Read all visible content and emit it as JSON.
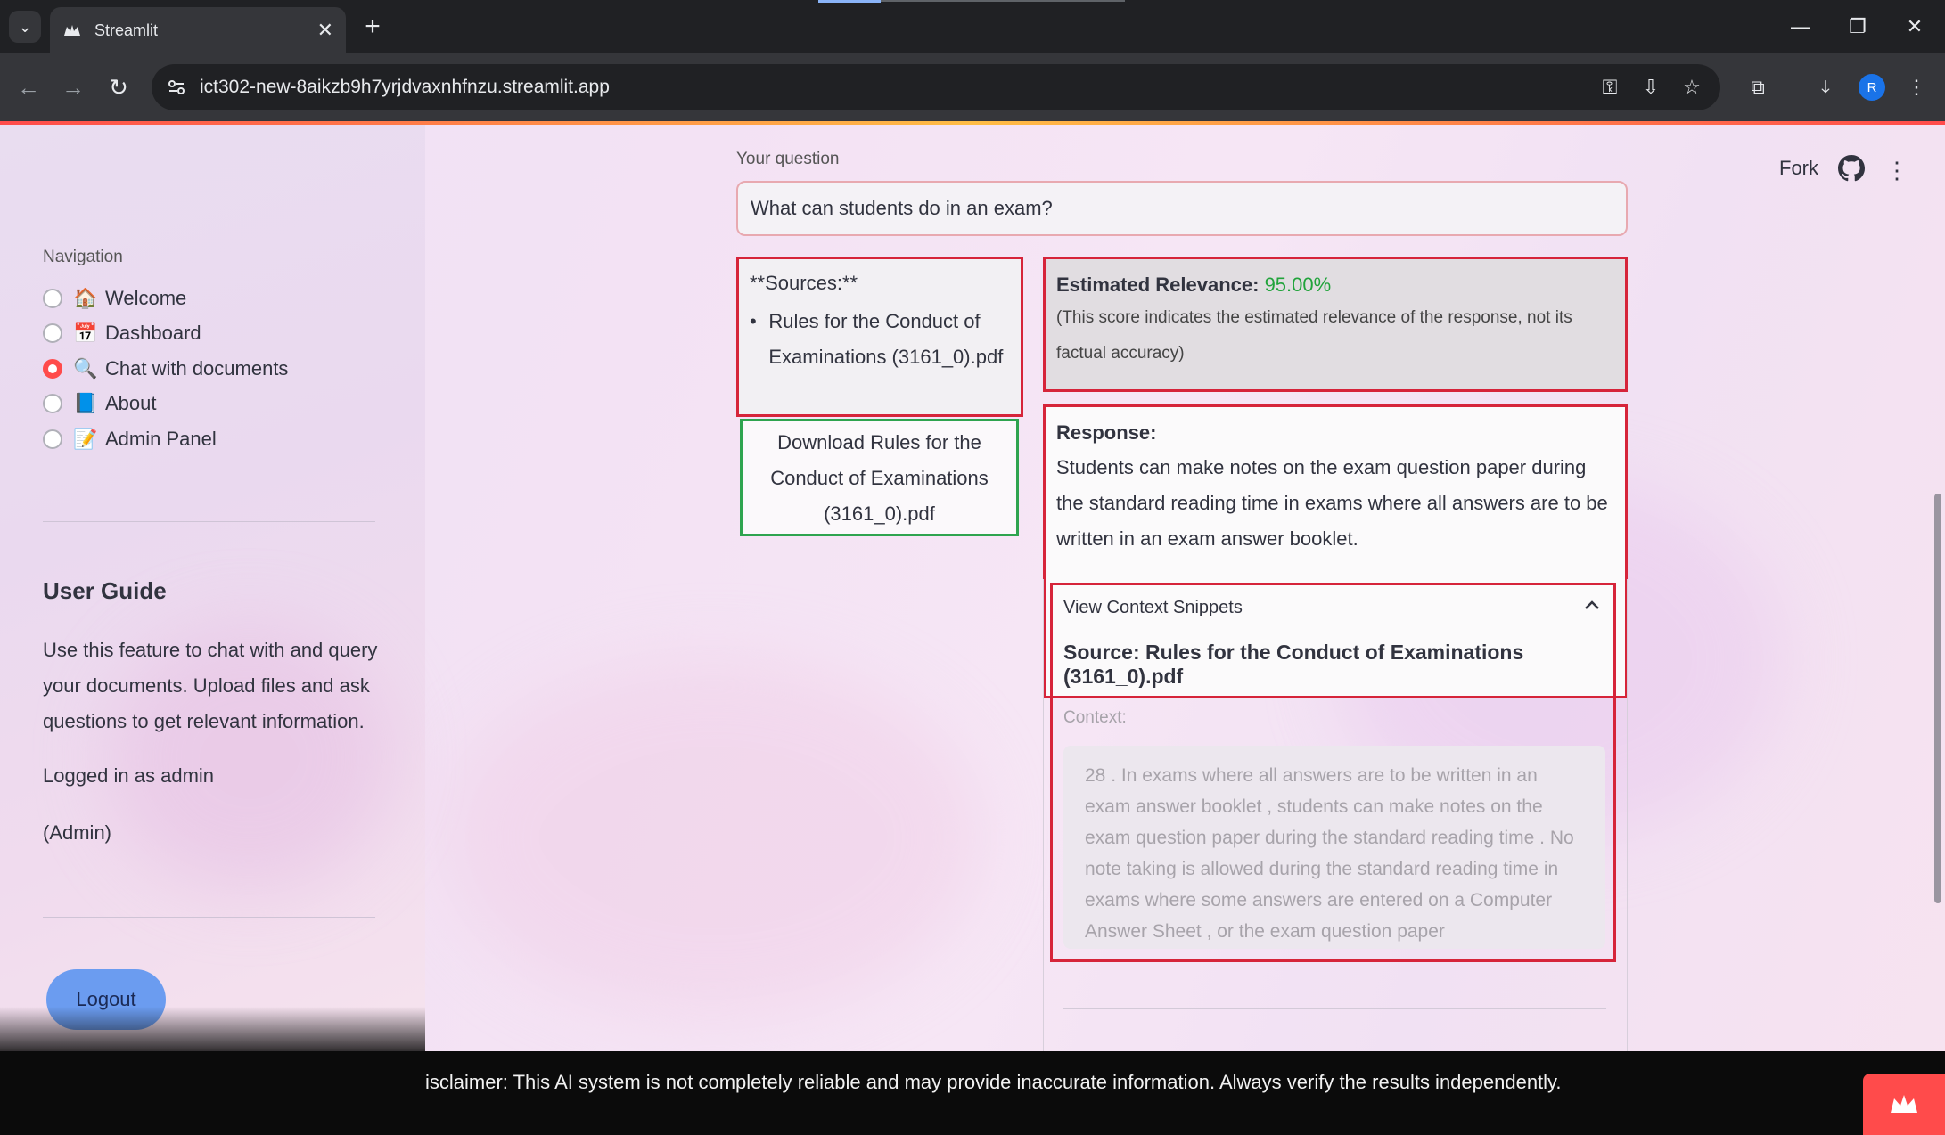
{
  "browser": {
    "tab_title": "Streamlit",
    "url": "ict302-new-8aikzb9h7yrjdvaxnhfnzu.streamlit.app",
    "profile_initial": "R"
  },
  "sidebar": {
    "nav_heading": "Navigation",
    "nav_items": [
      {
        "label": "Welcome",
        "icon": "house-icon",
        "selected": false
      },
      {
        "label": "Dashboard",
        "icon": "calendar-icon",
        "selected": false
      },
      {
        "label": "Chat with documents",
        "icon": "magnifier-icon",
        "selected": true
      },
      {
        "label": "About",
        "icon": "book-icon",
        "selected": false
      },
      {
        "label": "Admin Panel",
        "icon": "memo-icon",
        "selected": false
      }
    ],
    "guide_title": "User Guide",
    "guide_text": "Use this feature to chat with and query your documents. Upload files and ask questions to get relevant information.",
    "logged_in": "Logged in as admin",
    "role": "(Admin)",
    "logout_label": "Logout"
  },
  "header": {
    "fork_label": "Fork"
  },
  "main": {
    "question_label": "Your question",
    "question_value": "What can students do in an exam?",
    "sources_heading": "**Sources:**",
    "sources": [
      "Rules for the Conduct of Examinations (3161_0).pdf"
    ],
    "download_label": "Download Rules for the Conduct of Examinations (3161_0).pdf",
    "relevance_label": "Estimated Relevance:",
    "relevance_value": "95.00%",
    "relevance_note": "(This score indicates the estimated relevance of the response, not its factual accuracy)",
    "response_heading": "Response:",
    "response_text": "Students can make notes on the exam question paper during the standard reading time in exams where all answers are to be written in an exam answer booklet.",
    "expander_title": "View Context Snippets",
    "context_source": "Source: Rules for the Conduct of Examinations (3161_0).pdf",
    "context_label": "Context:",
    "context_text": "28 . In exams where all answers are to be written in an exam answer booklet , students can make notes on the exam question paper during the standard reading time . No note taking is allowed during the standard reading time in exams where some answers are entered on a Computer Answer Sheet , or the exam question paper"
  },
  "footer": {
    "disclaimer": "isclaimer: This AI system is not completely reliable and may provide inaccurate information. Always verify the results independently."
  },
  "colors": {
    "accent": "#ff4b4b",
    "highlight_border": "#d6243a",
    "download_border": "#2ea44f",
    "relevance_value": "#21a33b"
  }
}
